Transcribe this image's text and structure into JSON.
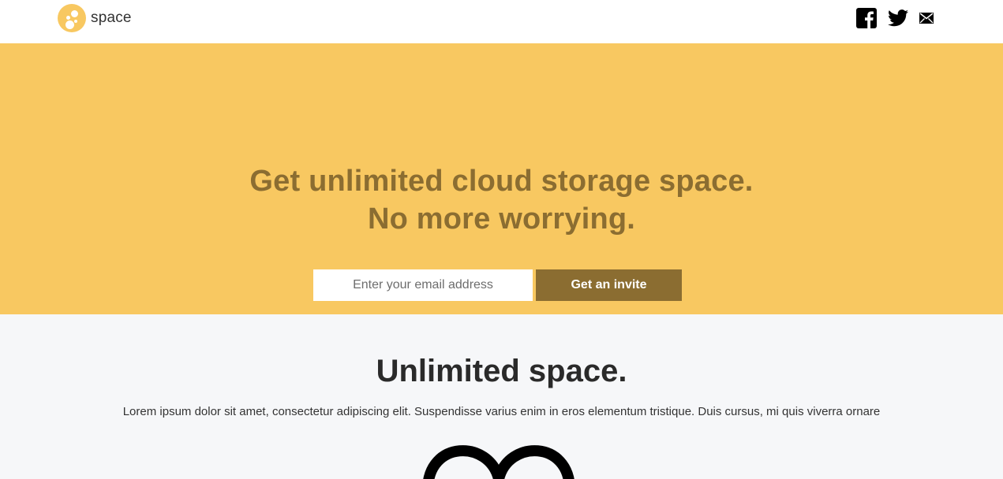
{
  "brand": {
    "name": "space",
    "color": "#f8c861"
  },
  "socials": [
    {
      "name": "facebook-icon"
    },
    {
      "name": "twitter-icon"
    },
    {
      "name": "mail-icon"
    }
  ],
  "hero": {
    "title_line1": "Get unlimited cloud storage space.",
    "title_line2": "No more worrying.",
    "email_placeholder": "Enter your email address",
    "button_label": "Get an invite",
    "background": "#f8c861",
    "accent": "#8b6d31"
  },
  "features": {
    "title": "Unlimited space.",
    "text": "Lorem ipsum dolor sit amet, consectetur adipiscing elit. Suspendisse varius enim in eros elementum tristique. Duis cursus, mi quis viverra ornare",
    "icon": "infinity-icon"
  }
}
